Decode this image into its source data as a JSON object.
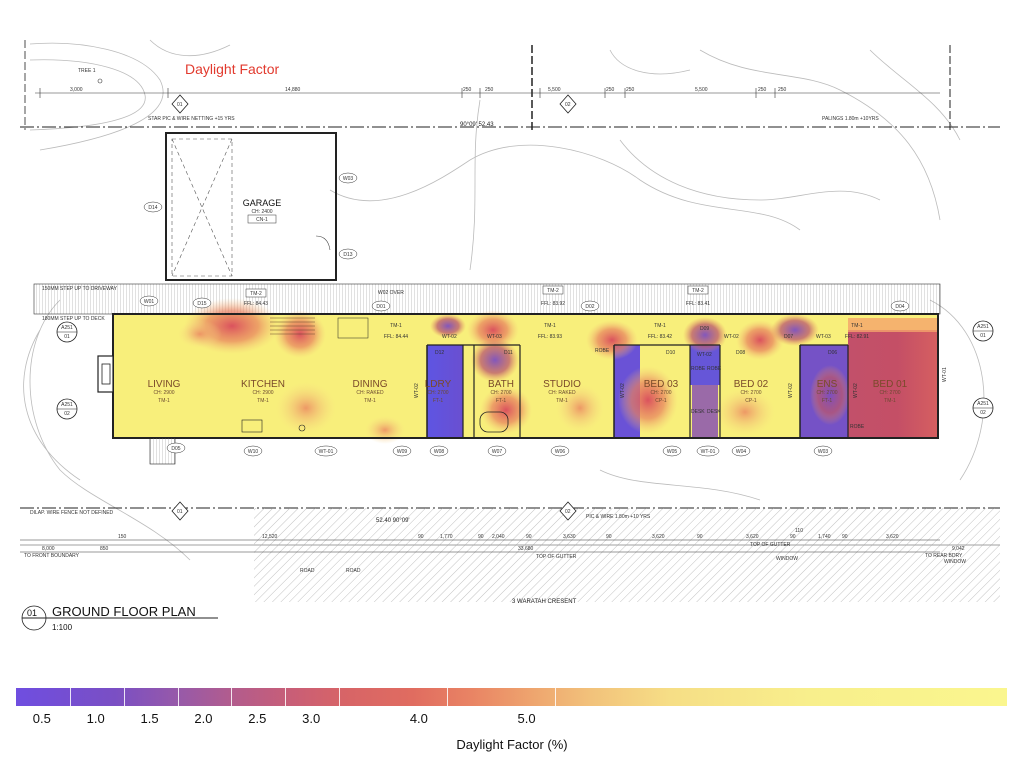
{
  "title": "Daylight Factor",
  "plan": {
    "title": "GROUND FLOOR PLAN",
    "number": "01",
    "scale": "1:100",
    "garage": {
      "name": "GARAGE",
      "ch": "CH: 2400",
      "finish": "CN-1"
    },
    "rooms": [
      {
        "id": "living",
        "name": "LIVING",
        "ch": "CH: 2900",
        "finish": "TM-1"
      },
      {
        "id": "kitchen",
        "name": "KITCHEN",
        "ch": "CH: 2900",
        "finish": "TM-1"
      },
      {
        "id": "dining",
        "name": "DINING",
        "ch": "CH: RAKED",
        "finish": "TM-1"
      },
      {
        "id": "ldry",
        "name": "LDRY",
        "ch": "CH: 2700",
        "finish": "FT-1"
      },
      {
        "id": "bath",
        "name": "BATH",
        "ch": "CH: 2700",
        "finish": "FT-1"
      },
      {
        "id": "studio",
        "name": "STUDIO",
        "ch": "CH: RAKED",
        "finish": "TM-1"
      },
      {
        "id": "bed03",
        "name": "BED 03",
        "ch": "CH: 2700",
        "finish": "CP-1"
      },
      {
        "id": "bed02",
        "name": "BED 02",
        "ch": "CH: 2700",
        "finish": "CP-1"
      },
      {
        "id": "ens",
        "name": "ENS",
        "ch": "CH: 2700",
        "finish": "FT-1"
      },
      {
        "id": "bed01",
        "name": "BED 01",
        "ch": "CH: 2700",
        "finish": "TM-1"
      }
    ],
    "ffl": [
      "FFL: 84.43",
      "FFL: 84.44",
      "FFL: 83.92",
      "FFL: 83.93",
      "FFL: 83.41",
      "FFL: 83.42",
      "FFL: 82.91"
    ],
    "tm": [
      "TM-2",
      "TM-1",
      "TM-2",
      "TM-1",
      "TM-2",
      "TM-1",
      "TM-1"
    ],
    "doors": [
      "D01",
      "D02",
      "D03",
      "D04",
      "D05",
      "D06",
      "D07",
      "D08",
      "D09",
      "D10",
      "D11",
      "D12",
      "D13",
      "D14",
      "D15"
    ],
    "windows": [
      "W01",
      "W02",
      "W03",
      "W04",
      "W05",
      "W06",
      "W07",
      "W08",
      "W09",
      "W10",
      "W02 OVER"
    ],
    "wt": [
      "WT-01",
      "WT-02",
      "WT-03"
    ],
    "fittings": [
      "ROBE",
      "DESK",
      "ROBE",
      "DESK",
      "ROBE",
      "ROBE"
    ],
    "section_refs": [
      "A251",
      "01",
      "02"
    ],
    "notes": {
      "fence_top": "STAR PIC & WIRE NETTING +15 YRS",
      "palings": "PALINGS 1.80m +10YRS",
      "fence_bottom": "DILAP. WIRE FENCE NOT DEFINED",
      "fence_bottom_right": "PIC & WIRE 1.80m +10 YRS",
      "step_driveway": "150MM STEP UP TO DRIVEWAY",
      "step_deck": "180MM STEP UP TO DECK",
      "front_boundary": "TO FRONT BOUNDARY",
      "rear_boundary": "TO REAR BDRY",
      "street": "3 WARATAH CRESENT",
      "bearing_top": "90°09' 52.43",
      "bearing_bottom": "52.40 90°09'",
      "top_of_gutter": "TOP OF GUTTER",
      "window": "WINDOW",
      "trees": "TREE 1",
      "road": "ROAD"
    },
    "dims_top": [
      "3,000",
      "14,880",
      "250",
      "250",
      "5,500",
      "250",
      "250",
      "5,500",
      "250",
      "250"
    ],
    "dims_bottom": [
      "8,000",
      "850",
      "150",
      "12,520",
      "90",
      "1,770",
      "90",
      "2,040",
      "90",
      "3,630",
      "90",
      "3,620",
      "90",
      "3,620",
      "90",
      "1,740",
      "90",
      "3,620",
      "9,042",
      "33,680",
      "110"
    ]
  },
  "legend": {
    "caption": "Daylight Factor (%)",
    "ticks": [
      "0.5",
      "1.0",
      "1.5",
      "2.0",
      "2.5",
      "3.0",
      "4.0",
      "5.0"
    ],
    "tick_values": [
      0.5,
      1.0,
      1.5,
      2.0,
      2.5,
      3.0,
      4.0,
      5.0
    ],
    "min": 0,
    "max": 9.2,
    "colors": {
      "low": "#6f4ee0",
      "mid": "#e06c60",
      "high": "#faf68e"
    }
  },
  "colors": {
    "title": "#e23a2e",
    "daylight_high": "#f9f27a",
    "daylight_mid": "#e8825e",
    "daylight_low": "#5a55e0"
  }
}
